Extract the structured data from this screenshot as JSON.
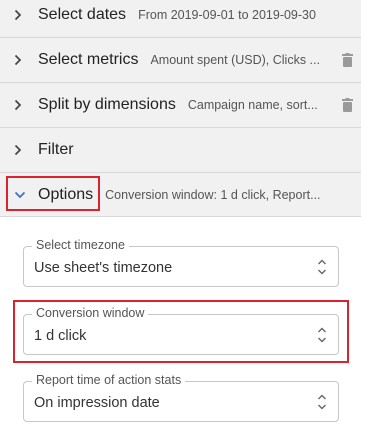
{
  "sections": [
    {
      "title": "Select dates",
      "summary": "From 2019-09-01 to 2019-09-30",
      "icon": "chevron-right-icon"
    },
    {
      "title": "Select metrics",
      "summary": "Amount spent (USD), Clicks ...",
      "icon": "chevron-right-icon",
      "trash": "trash-icon"
    },
    {
      "title": "Split by dimensions",
      "summary": "Campaign name, sort...",
      "icon": "chevron-right-icon",
      "trash": "trash-icon"
    },
    {
      "title": "Filter",
      "summary": "",
      "icon": "chevron-right-icon"
    },
    {
      "title": "Options",
      "summary": "Conversion window: 1 d click, Report...",
      "icon": "chevron-down-icon",
      "expanded": true
    }
  ],
  "options": {
    "timezone": {
      "label": "Select timezone",
      "value": "Use sheet's timezone"
    },
    "conversion_window": {
      "label": "Conversion window",
      "value": "1 d click"
    },
    "report_time": {
      "label": "Report time of action stats",
      "value": "On impression date"
    }
  },
  "colors": {
    "highlight": "#d9232e",
    "accent": "#3f6fd4",
    "row_background": "#f1f1f1"
  }
}
